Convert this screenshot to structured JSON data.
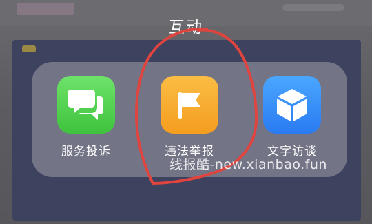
{
  "folder": {
    "title": "互动",
    "apps": [
      {
        "label": "服务投诉",
        "icon": "speech-bubbles-icon",
        "color": "#4cd04a"
      },
      {
        "label": "违法举报",
        "icon": "flag-icon",
        "color": "#f7a928"
      },
      {
        "label": "文字访谈",
        "icon": "cube-icon",
        "color": "#3a8cfb"
      }
    ]
  },
  "annotation": {
    "color": "#e0443f"
  },
  "watermark": {
    "text": "线报酷-new.xianbao.fun"
  }
}
